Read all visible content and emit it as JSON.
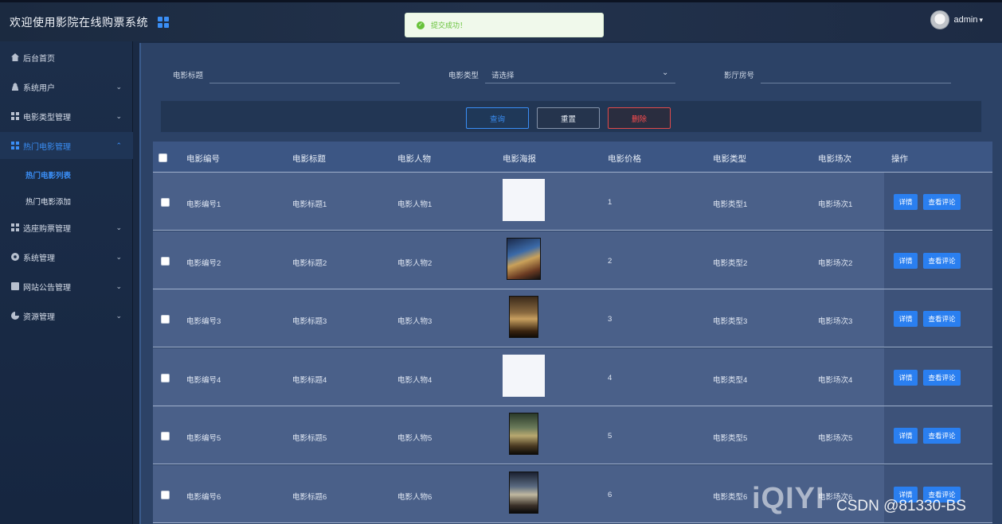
{
  "header": {
    "title": "欢迎使用影院在线购票系统",
    "user": "admin",
    "caret": "▾"
  },
  "toast": {
    "icon": "check-icon",
    "message": "提交成功！",
    "color": "#67c23a"
  },
  "sidebar": {
    "items": [
      {
        "label": "后台首页",
        "icon": "home-icon"
      },
      {
        "label": "系统用户",
        "icon": "user-icon",
        "chevron": "⌄"
      },
      {
        "label": "电影类型管理",
        "icon": "grid-icon",
        "chevron": "⌄"
      },
      {
        "label": "热门电影管理",
        "icon": "grid-icon",
        "chevron": "⌃",
        "active": true
      },
      {
        "label": "选座购票管理",
        "icon": "grid-icon",
        "chevron": "⌄"
      },
      {
        "label": "系统管理",
        "icon": "gear-icon",
        "chevron": "⌄"
      },
      {
        "label": "网站公告管理",
        "icon": "doc-icon",
        "chevron": "⌄"
      },
      {
        "label": "资源管理",
        "icon": "pie-icon",
        "chevron": "⌄"
      }
    ],
    "sub_items": [
      {
        "label": "热门电影列表",
        "active": true
      },
      {
        "label": "热门电影添加"
      }
    ]
  },
  "search": {
    "title_label": "电影标题",
    "title_value": "",
    "type_label": "电影类型",
    "type_value": "请选择",
    "hall_label": "影厅房号",
    "hall_value": ""
  },
  "buttons": {
    "query": "查询",
    "reset": "重置",
    "delete": "删除"
  },
  "table": {
    "headers": [
      "电影编号",
      "电影标题",
      "电影人物",
      "电影海报",
      "电影价格",
      "电影类型",
      "电影场次",
      "操作"
    ],
    "rows": [
      {
        "id": "电影编号1",
        "title": "电影标题1",
        "people": "电影人物1",
        "poster": "blank",
        "price": "1",
        "type": "电影类型1",
        "session": "电影场次1"
      },
      {
        "id": "电影编号2",
        "title": "电影标题2",
        "people": "电影人物2",
        "poster": "image",
        "price": "2",
        "type": "电影类型2",
        "session": "电影场次2"
      },
      {
        "id": "电影编号3",
        "title": "电影标题3",
        "people": "电影人物3",
        "poster": "image",
        "price": "3",
        "type": "电影类型3",
        "session": "电影场次3"
      },
      {
        "id": "电影编号4",
        "title": "电影标题4",
        "people": "电影人物4",
        "poster": "blank",
        "price": "4",
        "type": "电影类型4",
        "session": "电影场次4"
      },
      {
        "id": "电影编号5",
        "title": "电影标题5",
        "people": "电影人物5",
        "poster": "image",
        "price": "5",
        "type": "电影类型5",
        "session": "电影场次5"
      },
      {
        "id": "电影编号6",
        "title": "电影标题6",
        "people": "电影人物6",
        "poster": "image",
        "price": "6",
        "type": "电影类型6",
        "session": "电影场次6"
      }
    ],
    "detail_button": "详情",
    "comment_button": "查看评论"
  },
  "watermarks": {
    "logo": "iQIYI",
    "credit": "CSDN @81330-BS"
  }
}
